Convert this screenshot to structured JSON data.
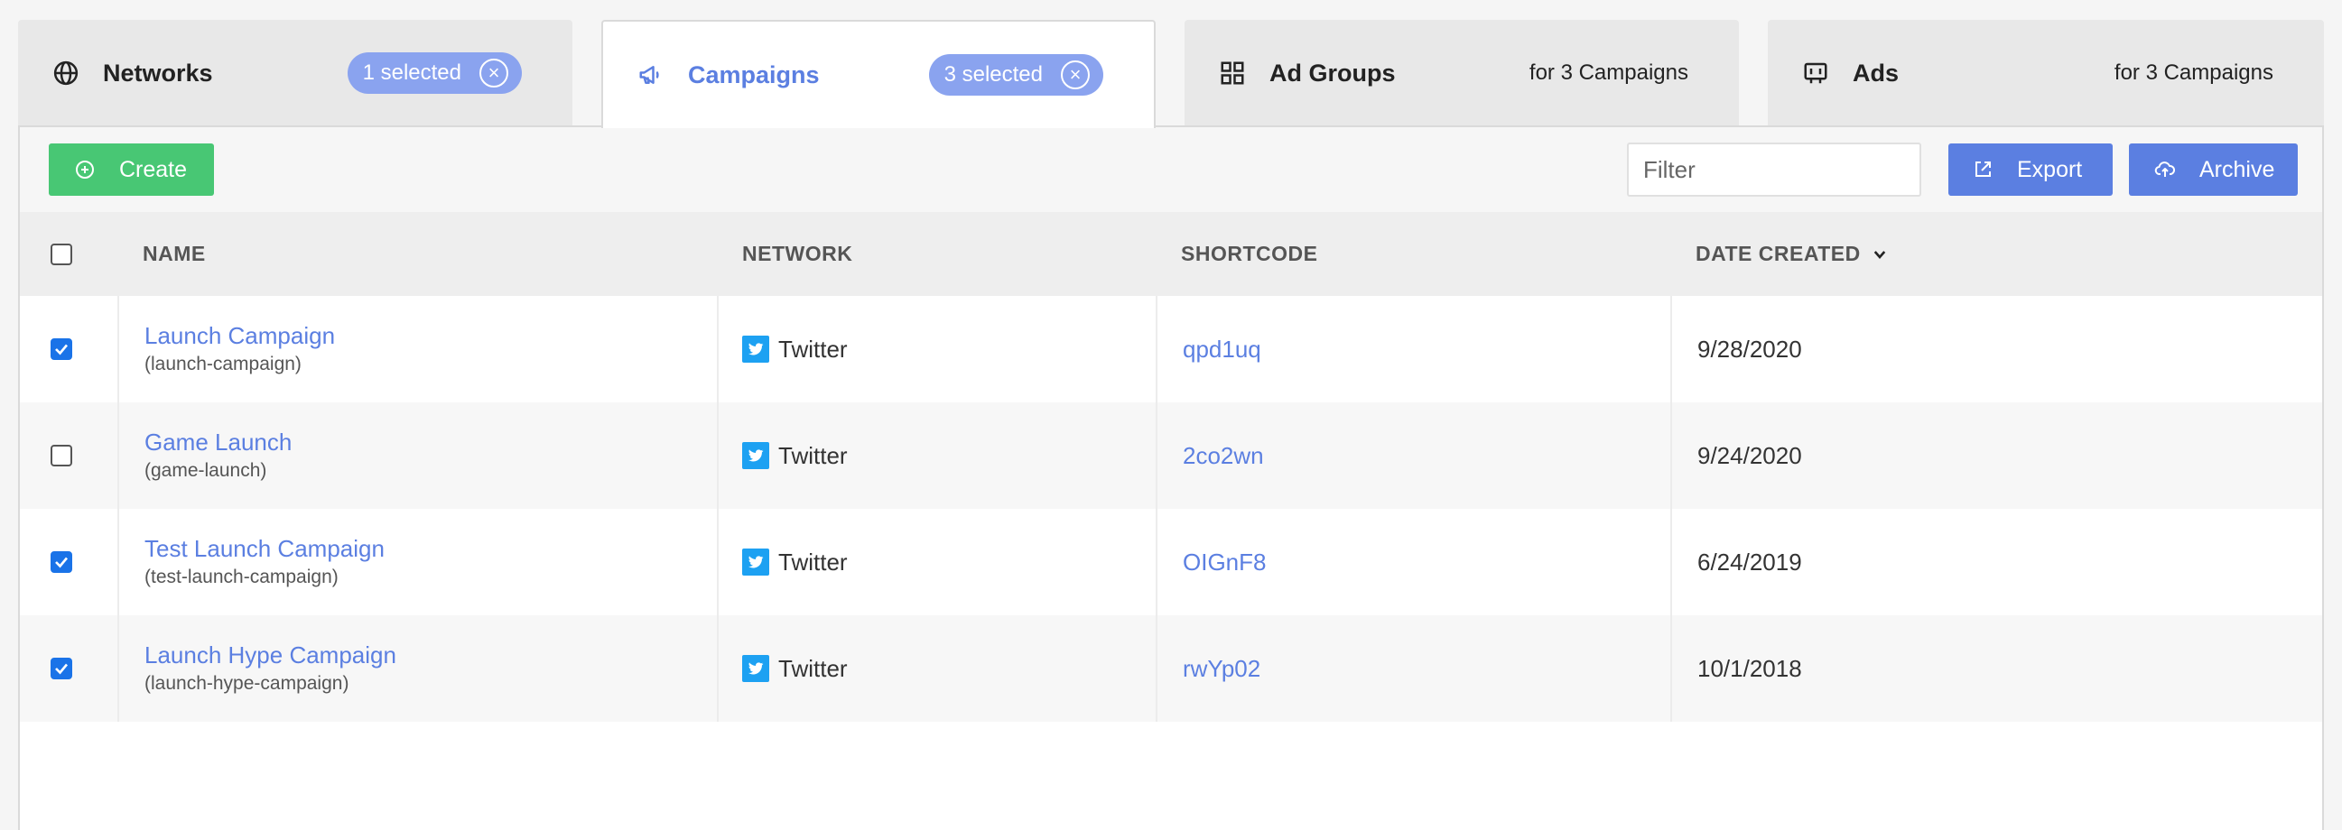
{
  "tabs": [
    {
      "label": "Networks",
      "icon": "globe-icon",
      "badge": "1 selected",
      "active": false
    },
    {
      "label": "Campaigns",
      "icon": "megaphone-icon",
      "badge": "3 selected",
      "active": true
    },
    {
      "label": "Ad Groups",
      "icon": "grid-icon",
      "note": "for 3 Campaigns",
      "active": false
    },
    {
      "label": "Ads",
      "icon": "ad-icon",
      "note": "for 3 Campaigns",
      "active": false
    }
  ],
  "toolbar": {
    "create_label": "Create",
    "filter_placeholder": "Filter",
    "filter_value": "",
    "export_label": "Export",
    "archive_label": "Archive"
  },
  "table": {
    "columns": [
      "NAME",
      "NETWORK",
      "SHORTCODE",
      "DATE CREATED"
    ],
    "sort_column": "DATE CREATED",
    "sort_direction": "desc",
    "rows": [
      {
        "checked": true,
        "name": "Launch Campaign",
        "slug": "(launch-campaign)",
        "network": "Twitter",
        "shortcode": "qpd1uq",
        "date": "9/28/2020"
      },
      {
        "checked": false,
        "name": "Game Launch",
        "slug": "(game-launch)",
        "network": "Twitter",
        "shortcode": "2co2wn",
        "date": "9/24/2020"
      },
      {
        "checked": true,
        "name": "Test Launch Campaign",
        "slug": "(test-launch-campaign)",
        "network": "Twitter",
        "shortcode": "OIGnF8",
        "date": "6/24/2019"
      },
      {
        "checked": true,
        "name": "Launch Hype Campaign",
        "slug": "(launch-hype-campaign)",
        "network": "Twitter",
        "shortcode": "rwYp02",
        "date": "10/1/2018"
      }
    ]
  },
  "colors": {
    "accent": "#5b7fe1",
    "badge": "#8aa3ef",
    "create": "#48c774",
    "checkbox": "#1a73e8",
    "twitter": "#1da1f2"
  }
}
